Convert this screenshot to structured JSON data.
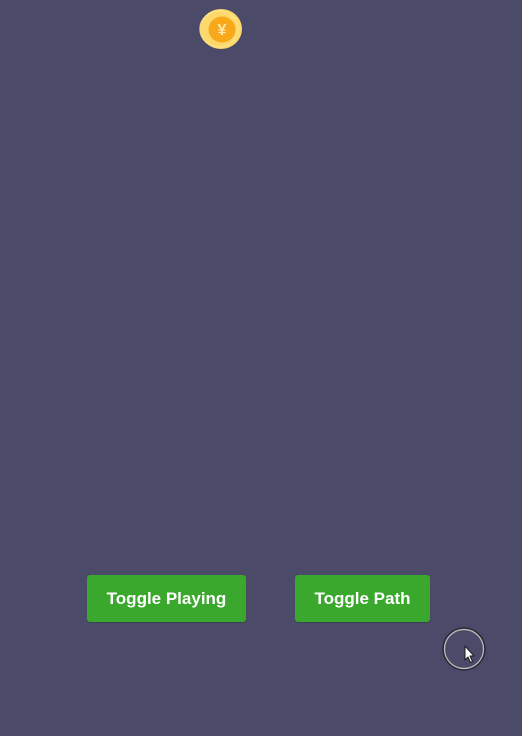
{
  "coin": {
    "icon": "yen-coin-icon",
    "symbol": "¥",
    "colors": {
      "outer": "#fdd96b",
      "inner": "#f7a81b",
      "symbol": "#ffe9a6"
    }
  },
  "buttons": {
    "toggle_playing_label": "Toggle Playing",
    "toggle_path_label": "Toggle Path"
  },
  "cursor": {
    "icon": "mouse-pointer-icon",
    "ring_icon": "click-indicator-ring-icon"
  },
  "colors": {
    "background": "#4b4a69",
    "button": "#3aa82c",
    "button_text": "#ffffff"
  }
}
